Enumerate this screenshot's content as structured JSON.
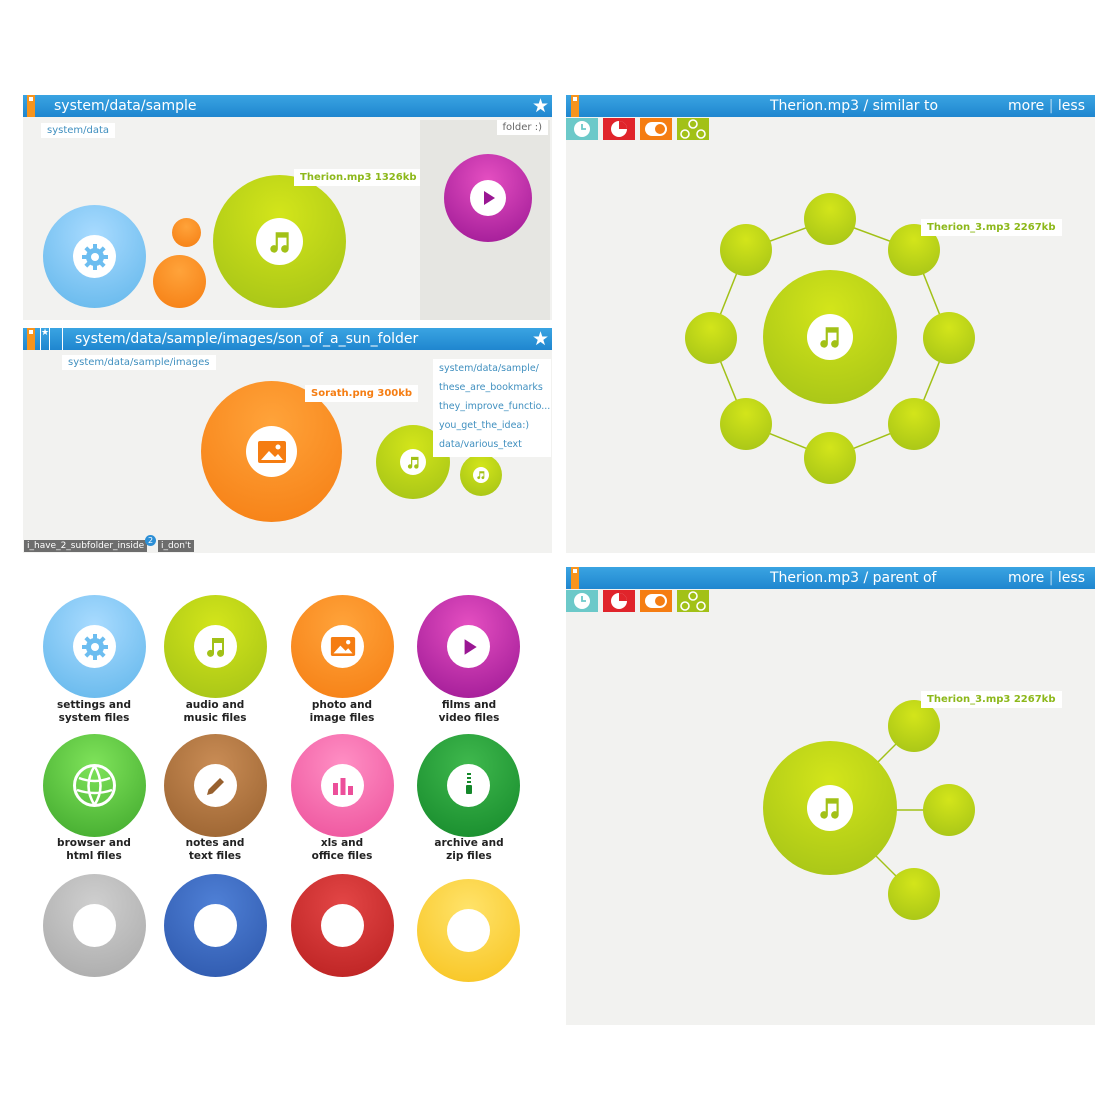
{
  "panel1": {
    "path": "system/data/sample",
    "crumb": "system/data",
    "folder_label": "folder :)",
    "tooltip": "Therion.mp3  1326kb"
  },
  "panel2": {
    "path": "system/data/sample/images/son_of_a_sun_folder",
    "crumb": "system/data/sample/images",
    "tooltip": "Sorath.png  300kb",
    "bookmarks": [
      "system/data/sample/",
      "these_are_bookmarks",
      "they_improve_functio...",
      "you_get_the_idea:)",
      "data/various_text"
    ],
    "tags": [
      "i_have_2_subfolder_inside",
      "i_don't"
    ],
    "badge": "2"
  },
  "panel3": {
    "title": "Therion.mp3 / similar to",
    "more": "more",
    "less": "less",
    "tooltip": "Therion_3.mp3  2267kb"
  },
  "panel4": {
    "title": "Therion.mp3 / parent of",
    "more": "more",
    "less": "less",
    "tooltip": "Therion_3.mp3  2267kb"
  },
  "legend": [
    {
      "line1": "settings and",
      "line2": "system files",
      "color": "#5fb5ea",
      "icon": "gear-icon"
    },
    {
      "line1": "audio and",
      "line2": "music files",
      "color": "#a2c117",
      "icon": "music-note-icon"
    },
    {
      "line1": "photo and",
      "line2": "image files",
      "color": "#f57d12",
      "icon": "image-icon"
    },
    {
      "line1": "films and",
      "line2": "video files",
      "color": "#9a1693",
      "icon": "play-icon"
    },
    {
      "line1": "browser and",
      "line2": "html files",
      "color": "#3ea62b",
      "icon": "globe-icon"
    },
    {
      "line1": "notes and",
      "line2": "text files",
      "color": "#97602e",
      "icon": "pencil-icon"
    },
    {
      "line1": "xls and",
      "line2": "office files",
      "color": "#ec4f9a",
      "icon": "bar-chart-icon"
    },
    {
      "line1": "archive and",
      "line2": "zip files",
      "color": "#14882a",
      "icon": "zipper-icon"
    }
  ],
  "colors": {
    "bar": "#1f86cf",
    "panel_bg": "#f2f2f0",
    "tool_history": "#6cc9c9",
    "tool_pie": "#e0242b",
    "tool_toggle": "#f57d12",
    "tool_network": "#a2c117"
  }
}
